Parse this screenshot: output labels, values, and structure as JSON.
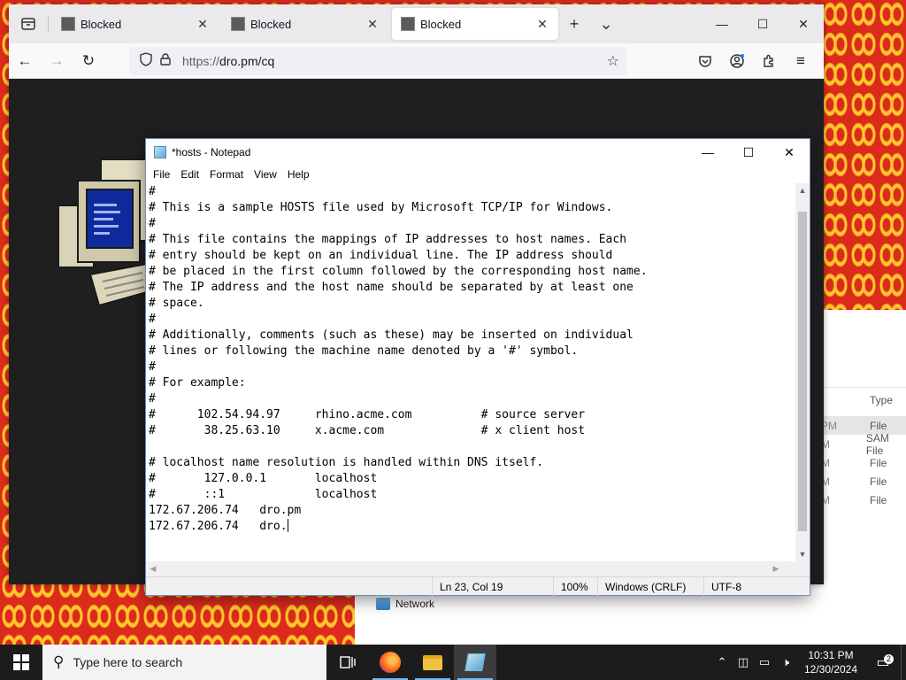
{
  "firefox": {
    "tabs": [
      {
        "title": "Blocked",
        "active": false
      },
      {
        "title": "Blocked",
        "active": false
      },
      {
        "title": "Blocked",
        "active": true
      }
    ],
    "url_prefix": "https://",
    "url_host": "dro.pm/cq"
  },
  "explorer": {
    "type_header": "Type",
    "rows": [
      {
        "time": "PM",
        "type": "File"
      },
      {
        "time": "M",
        "type": "SAM File"
      },
      {
        "time": "M",
        "type": "File"
      },
      {
        "time": "M",
        "type": "File"
      },
      {
        "time": "M",
        "type": "File"
      }
    ],
    "network_label": "Network"
  },
  "notepad": {
    "caption": "*hosts - Notepad",
    "menu": [
      "File",
      "Edit",
      "Format",
      "View",
      "Help"
    ],
    "lines": [
      "#",
      "# This is a sample HOSTS file used by Microsoft TCP/IP for Windows.",
      "#",
      "# This file contains the mappings of IP addresses to host names. Each",
      "# entry should be kept on an individual line. The IP address should",
      "# be placed in the first column followed by the corresponding host name.",
      "# The IP address and the host name should be separated by at least one",
      "# space.",
      "#",
      "# Additionally, comments (such as these) may be inserted on individual",
      "# lines or following the machine name denoted by a '#' symbol.",
      "#",
      "# For example:",
      "#",
      "#      102.54.94.97     rhino.acme.com          # source server",
      "#       38.25.63.10     x.acme.com              # x client host",
      "",
      "# localhost name resolution is handled within DNS itself.",
      "#       127.0.0.1       localhost",
      "#       ::1             localhost",
      "172.67.206.74   dro.pm",
      "172.67.206.74   dro."
    ],
    "status": {
      "position": "Ln 23, Col 19",
      "zoom": "100%",
      "line_ending": "Windows (CRLF)",
      "encoding": "UTF-8"
    }
  },
  "taskbar": {
    "search_placeholder": "Type here to search",
    "time": "10:31 PM",
    "date": "12/30/2024",
    "notification_count": "2"
  }
}
